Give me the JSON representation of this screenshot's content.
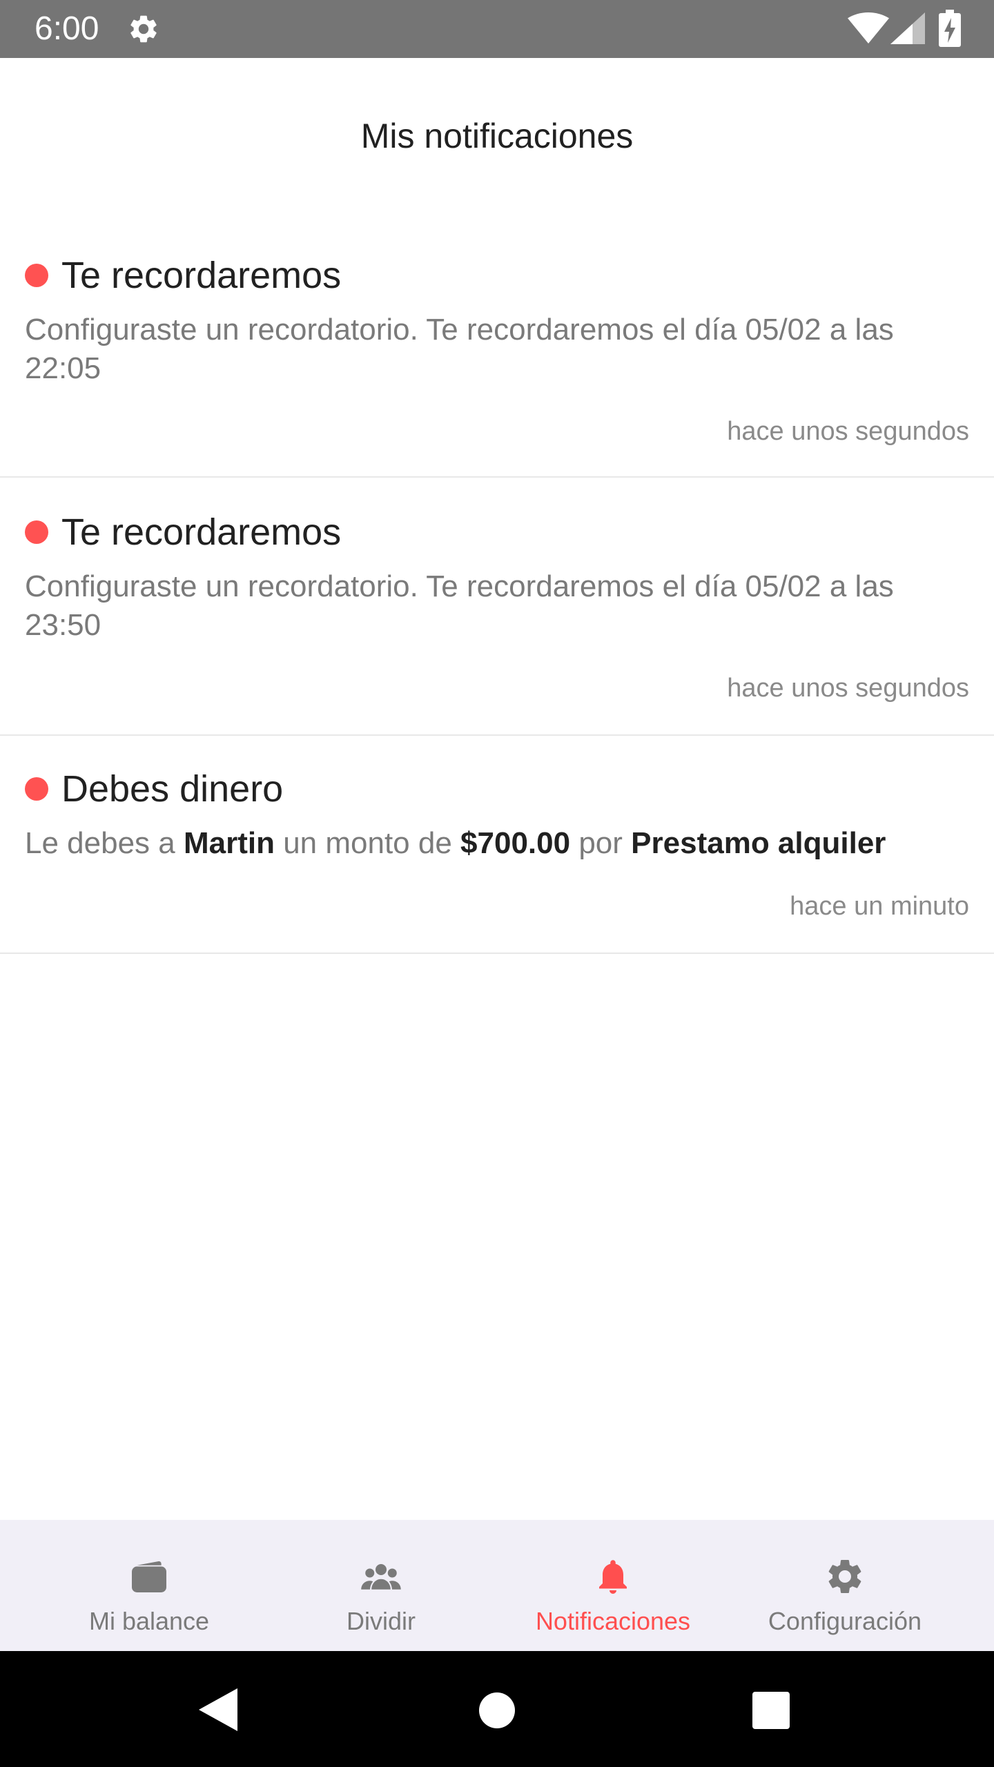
{
  "status_bar": {
    "time": "6:00",
    "icons": [
      "settings-icon",
      "wifi-icon",
      "signal-icon",
      "battery-charging-icon"
    ]
  },
  "header": {
    "title": "Mis notificaciones"
  },
  "colors": {
    "accent": "#ff4f4f",
    "unread_dot": "#ff5252",
    "status_bar": "#757575",
    "bottom_nav_bg": "#f1eff7"
  },
  "notifications": [
    {
      "title": "Te recordaremos",
      "body": "Configuraste un recordatorio. Te recordaremos el día 05/02 a las 22:05",
      "time": "hace unos segundos",
      "unread": true
    },
    {
      "title": "Te recordaremos",
      "body": "Configuraste un recordatorio. Te recordaremos el día 05/02 a las 23:50",
      "time": "hace unos segundos",
      "unread": true
    },
    {
      "title": "Debes dinero",
      "body_parts": {
        "prefix": "Le debes a ",
        "person": "Martin",
        "middle": " un monto de ",
        "amount": "$700.00",
        "connector": " por ",
        "concept": "Prestamo alquiler"
      },
      "time": "hace un minuto",
      "unread": true
    }
  ],
  "bottom_nav": {
    "items": [
      {
        "label": "Mi balance",
        "icon": "wallet-icon",
        "active": false
      },
      {
        "label": "Dividir",
        "icon": "group-icon",
        "active": false
      },
      {
        "label": "Notificaciones",
        "icon": "bell-icon",
        "active": true
      },
      {
        "label": "Configuración",
        "icon": "gear-icon",
        "active": false
      }
    ]
  },
  "system_nav": {
    "icons": [
      "back-icon",
      "home-icon",
      "recents-icon"
    ]
  }
}
